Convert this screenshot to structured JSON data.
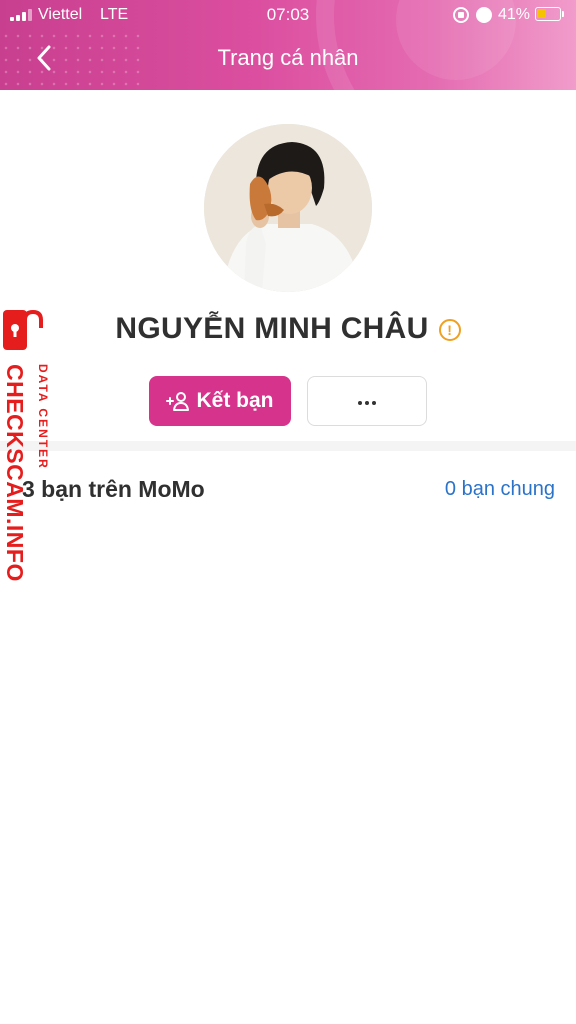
{
  "status_bar": {
    "carrier": "Viettel",
    "network": "LTE",
    "time": "07:03",
    "battery_percent": "41%",
    "battery_level": 0.41
  },
  "header": {
    "title": "Trang cá nhân",
    "back_icon": "chevron-left-icon",
    "gradient_colors": [
      "#c93f8f",
      "#f19ccb"
    ]
  },
  "profile": {
    "name": "NGUYỄN MINH CHÂU",
    "warning_icon": "warning-circle-icon",
    "warning_color": "#f0a020"
  },
  "actions": {
    "add_friend_label": "Kết bạn",
    "add_friend_icon": "add-user-icon",
    "add_friend_color": "#d6338d",
    "more_icon": "ellipsis-icon"
  },
  "friends": {
    "count_label": "3 bạn trên MoMo",
    "mutual_label": "0 bạn chung",
    "mutual_color": "#2b73c9"
  },
  "watermark": {
    "main": "CHECKSCAM.INFO",
    "sub": "DATA CENTER",
    "color": "#e51d1d"
  }
}
